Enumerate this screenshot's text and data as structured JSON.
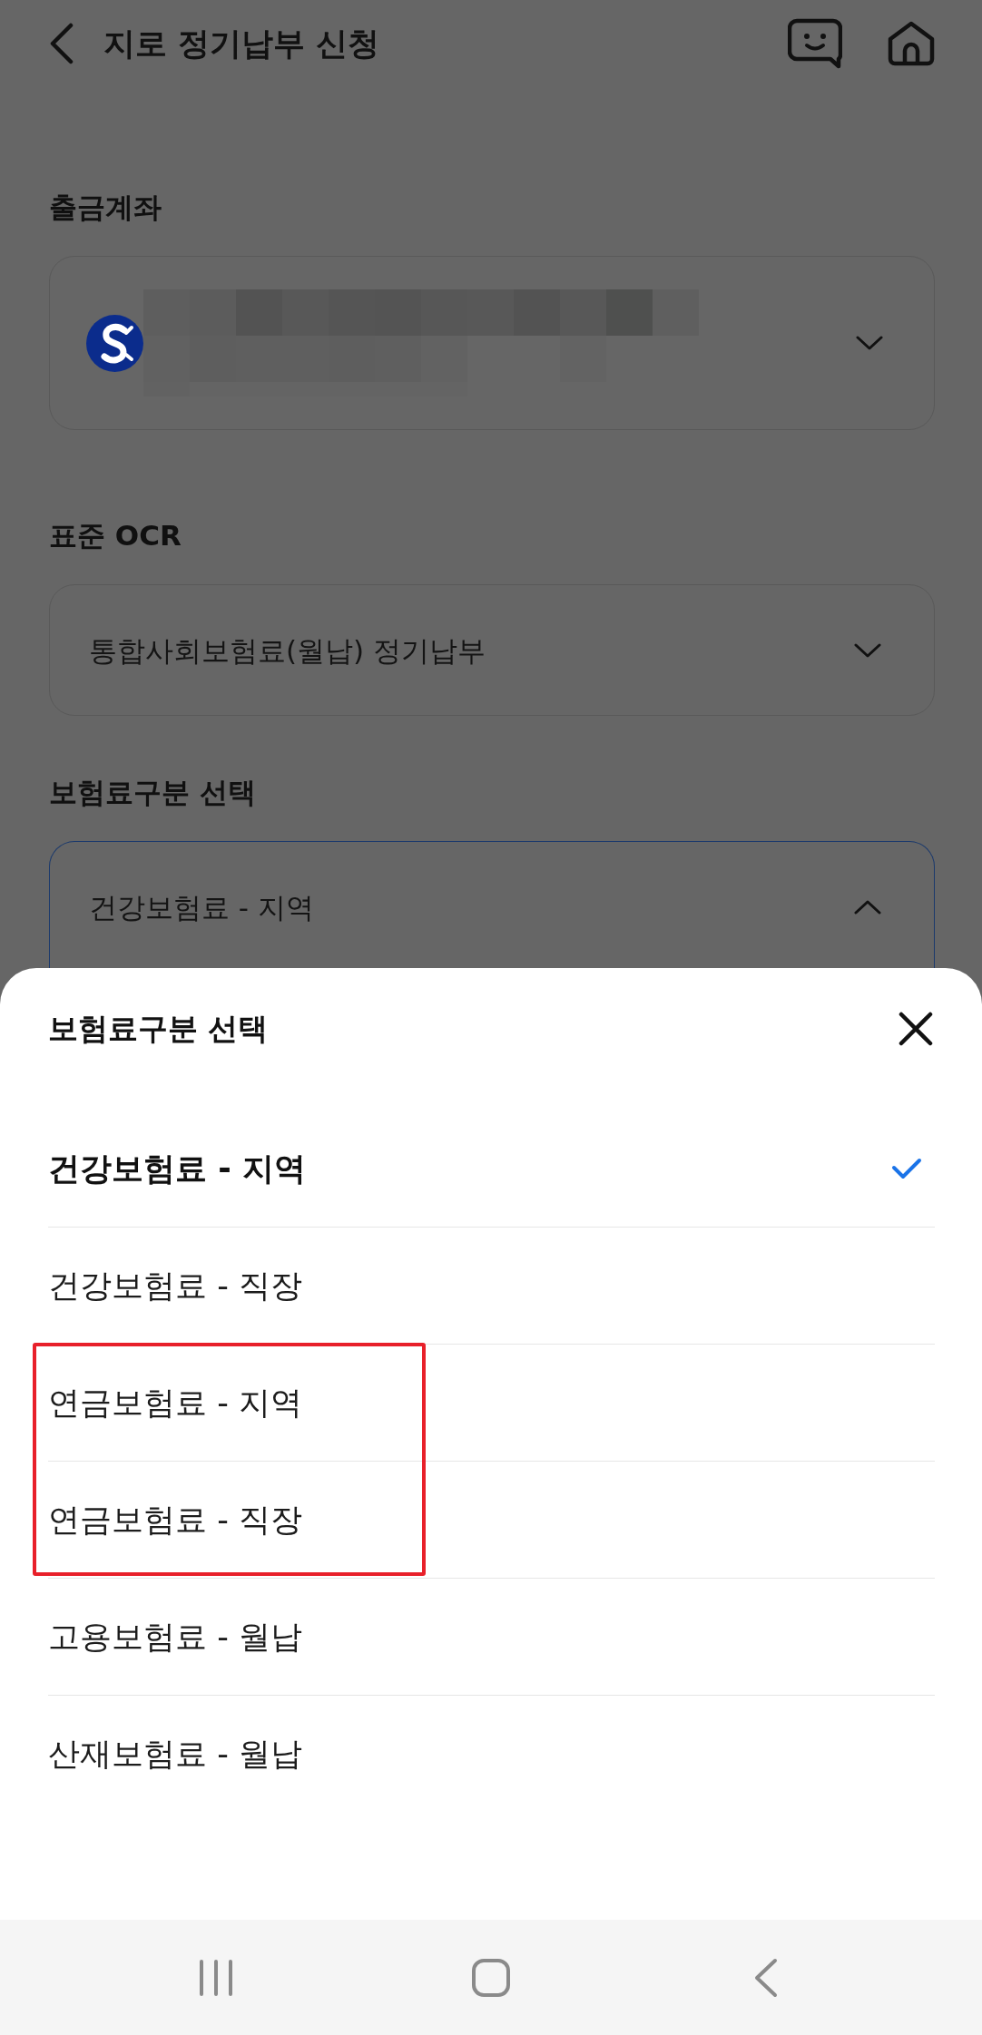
{
  "header": {
    "title": "지로 정기납부 신청"
  },
  "sections": [
    {
      "kind": "account",
      "label": "출금계좌",
      "expanded": false
    },
    {
      "kind": "select",
      "label": "표준 OCR",
      "value": "통합사회보험료(월납) 정기납부",
      "expanded": false
    },
    {
      "kind": "select",
      "label": "보험료구분 선택",
      "value": "건강보험료 - 지역",
      "expanded": true
    }
  ],
  "sheet": {
    "title": "보험료구분 선택",
    "options": [
      {
        "label": "건강보험료 - 지역",
        "selected": true,
        "highlighted": false
      },
      {
        "label": "건강보험료 - 직장",
        "selected": false,
        "highlighted": false
      },
      {
        "label": "연금보험료 - 지역",
        "selected": false,
        "highlighted": true
      },
      {
        "label": "연금보험료 - 직장",
        "selected": false,
        "highlighted": true
      },
      {
        "label": "고용보험료 - 월납",
        "selected": false,
        "highlighted": false
      },
      {
        "label": "산재보험료 - 월납",
        "selected": false,
        "highlighted": false
      }
    ]
  }
}
